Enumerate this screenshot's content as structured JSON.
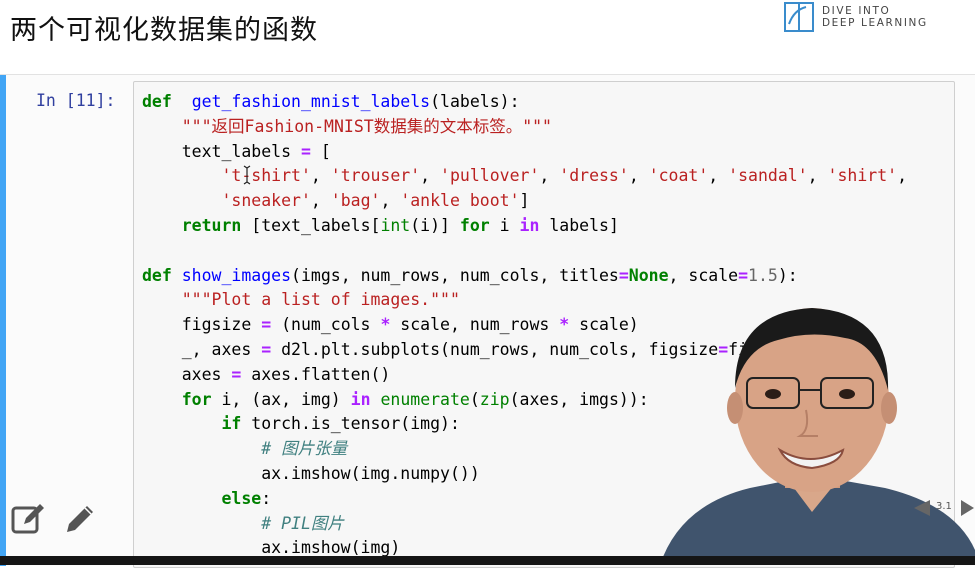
{
  "slide": {
    "title": "两个可视化数据集的函数"
  },
  "logo": {
    "line1": "DIVE INTO",
    "line2": "DEEP LEARNING"
  },
  "cell": {
    "prompt": "In [11]:",
    "lines": [
      [
        [
          "kw",
          "def"
        ],
        [
          "",
          "  "
        ],
        [
          "fn",
          "get_fashion_mnist_labels"
        ],
        [
          "",
          "(labels):"
        ]
      ],
      [
        [
          "",
          "    "
        ],
        [
          "st",
          "\"\"\"返回Fashion-MNIST数据集的文本标签。\"\"\""
        ]
      ],
      [
        [
          "",
          "    text_labels "
        ],
        [
          "op",
          "="
        ],
        [
          "",
          " ["
        ]
      ],
      [
        [
          "",
          "        "
        ],
        [
          "st",
          "'t-shirt'"
        ],
        [
          "",
          ", "
        ],
        [
          "st",
          "'trouser'"
        ],
        [
          "",
          ", "
        ],
        [
          "st",
          "'pullover'"
        ],
        [
          "",
          ", "
        ],
        [
          "st",
          "'dress'"
        ],
        [
          "",
          ", "
        ],
        [
          "st",
          "'coat'"
        ],
        [
          "",
          ", "
        ],
        [
          "st",
          "'sandal'"
        ],
        [
          "",
          ", "
        ],
        [
          "st",
          "'shirt'"
        ],
        [
          "",
          ","
        ]
      ],
      [
        [
          "",
          "        "
        ],
        [
          "st",
          "'sneaker'"
        ],
        [
          "",
          ", "
        ],
        [
          "st",
          "'bag'"
        ],
        [
          "",
          ", "
        ],
        [
          "st",
          "'ankle boot'"
        ],
        [
          "",
          "]"
        ]
      ],
      [
        [
          "",
          "    "
        ],
        [
          "kw",
          "return"
        ],
        [
          "",
          " [text_labels["
        ],
        [
          "bi",
          "int"
        ],
        [
          "",
          "(i)] "
        ],
        [
          "kw",
          "for"
        ],
        [
          "",
          " i "
        ],
        [
          "op",
          "in"
        ],
        [
          "",
          " labels]"
        ]
      ],
      [
        [
          "",
          ""
        ]
      ],
      [
        [
          "kw",
          "def"
        ],
        [
          "",
          " "
        ],
        [
          "fn",
          "show_images"
        ],
        [
          "",
          "(imgs, num_rows, num_cols, titles"
        ],
        [
          "op",
          "="
        ],
        [
          "kw",
          "None"
        ],
        [
          "",
          ", scale"
        ],
        [
          "op",
          "="
        ],
        [
          "nm",
          "1.5"
        ],
        [
          "",
          "):"
        ]
      ],
      [
        [
          "",
          "    "
        ],
        [
          "st",
          "\"\"\"Plot a list of images.\"\"\""
        ]
      ],
      [
        [
          "",
          "    figsize "
        ],
        [
          "op",
          "="
        ],
        [
          "",
          " (num_cols "
        ],
        [
          "op",
          "*"
        ],
        [
          "",
          " scale, num_rows "
        ],
        [
          "op",
          "*"
        ],
        [
          "",
          " scale)"
        ]
      ],
      [
        [
          "",
          "    _, axes "
        ],
        [
          "op",
          "="
        ],
        [
          "",
          " d2l.plt.subplots(num_rows, num_cols, figsize"
        ],
        [
          "op",
          "="
        ],
        [
          "",
          "figsize)"
        ]
      ],
      [
        [
          "",
          "    axes "
        ],
        [
          "op",
          "="
        ],
        [
          "",
          " axes.flatten()"
        ]
      ],
      [
        [
          "",
          "    "
        ],
        [
          "kw",
          "for"
        ],
        [
          "",
          " i, (ax, img) "
        ],
        [
          "op",
          "in"
        ],
        [
          "",
          " "
        ],
        [
          "bi",
          "enumerate"
        ],
        [
          "",
          "("
        ],
        [
          "bi",
          "zip"
        ],
        [
          "",
          "(axes, imgs)):"
        ]
      ],
      [
        [
          "",
          "        "
        ],
        [
          "kw",
          "if"
        ],
        [
          "",
          " torch.is_tensor(img):"
        ]
      ],
      [
        [
          "",
          "            "
        ],
        [
          "cm",
          "# 图片张量"
        ]
      ],
      [
        [
          "",
          "            ax.imshow(img.numpy())"
        ]
      ],
      [
        [
          "",
          "        "
        ],
        [
          "kw",
          "else"
        ],
        [
          "",
          ":"
        ]
      ],
      [
        [
          "",
          "            "
        ],
        [
          "cm",
          "# PIL图片"
        ]
      ],
      [
        [
          "",
          "            ax.imshow(img)"
        ]
      ]
    ]
  },
  "pager": {
    "page_label": "3.1"
  },
  "colors": {
    "accent": "#42a5f5",
    "keyword": "#008000",
    "string": "#ba2121",
    "function": "#0000ff",
    "comment": "#408080",
    "prompt": "#303f9f"
  },
  "icons": {
    "edit": "edit-note-icon",
    "pencil": "pencil-icon",
    "prev": "triangle-left-icon",
    "next": "triangle-right-icon",
    "cursor": "text-cursor-icon"
  }
}
